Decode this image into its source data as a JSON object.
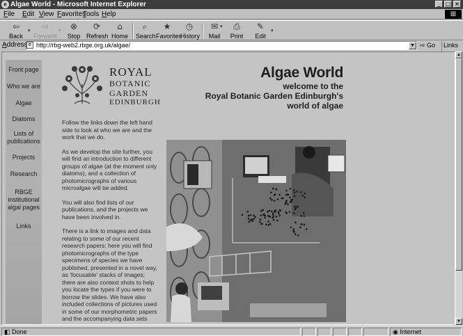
{
  "window": {
    "title": "Algae World - Microsoft Internet Explorer",
    "ie_icon": "e",
    "minimize": "_",
    "maximize": "□",
    "close": "×"
  },
  "menu": [
    "File",
    "Edit",
    "View",
    "Favorites",
    "Tools",
    "Help"
  ],
  "toolbar": {
    "back": "Back",
    "forward": "Forward",
    "stop": "Stop",
    "refresh": "Refresh",
    "home": "Home",
    "search": "Search",
    "favorites": "Favorites",
    "history": "History",
    "mail": "Mail",
    "print": "Print",
    "edit": "Edit",
    "icons": {
      "back": "back-arrow-icon",
      "forward": "forward-arrow-icon",
      "stop": "stop-icon",
      "refresh": "refresh-icon",
      "home": "home-icon",
      "search": "search-icon",
      "favorites": "favorites-icon",
      "history": "history-icon",
      "mail": "mail-icon",
      "print": "printer-icon",
      "edit": "edit-icon"
    }
  },
  "address": {
    "label": "Address",
    "url": "http://rbg-web2.rbge.org.uk/algae/",
    "go": "Go",
    "links": "Links"
  },
  "sidebar": {
    "items": [
      {
        "label": "Front page"
      },
      {
        "label": "Who we are"
      },
      {
        "label": "Algae"
      },
      {
        "label": "Diatoms"
      },
      {
        "label": "Lists of publications"
      },
      {
        "label": "Projects"
      },
      {
        "label": "Research"
      },
      {
        "label": "RBGE institutional algal pages"
      },
      {
        "label": "Links"
      }
    ]
  },
  "logo": {
    "line1": "ROYAL",
    "line2": "BOTANIC",
    "line3": "GARDEN",
    "line4": "EDINBURGH"
  },
  "header": {
    "title": "Algae World",
    "welcome1": "welcome to the",
    "welcome2": "Royal Botanic Garden Edinburgh's",
    "welcome3": "world of algae"
  },
  "content": {
    "p1": "Follow the links down the left hand side to look at who we are and the work that we do.",
    "p2": "As we develop the site further, you will find an introduction to different groups of algae (at the moment only diatoms), and a collection of photomicrographs of various microalgae will be added.",
    "p3": "You will also find lists of our publications, and the projects we have been involved in.",
    "p4": "There is a link to images and data relating to some of our recent research papers: here you will find photomicrographs of the type specimens of species we have published, presented in a novel way, as 'focusable' stacks of images; there are also context shots to help you locate the types if you were to borrow the slides. We have also included collections of pictures used in some of our morphometric papers and the accompanying data sets"
  },
  "status": {
    "left": "Done",
    "zone": "Internet"
  },
  "colors": {
    "titlebar": "#3c3c3c",
    "chrome": "#c0c0c0",
    "page_bg": "#c4c4c4",
    "sidebar": "#a8a8a8"
  }
}
